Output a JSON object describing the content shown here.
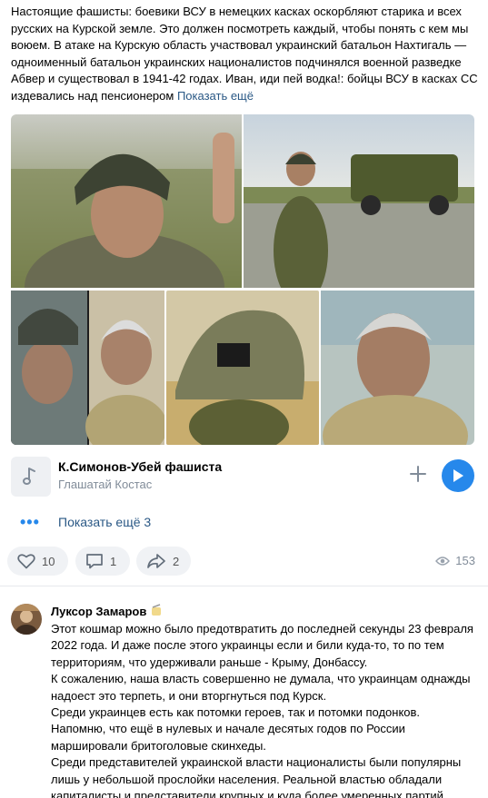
{
  "post": {
    "text": "Настоящие фашисты: боевики ВСУ в немецких касках оскорбляют старика и всех русских на Курской земле. Это должен посмотреть каждый, чтобы понять с кем мы воюем. В атаке на Курскую область участвовал украинский батальон Нахтигаль — одноименный батальон украинских националистов подчинялся военной разведке Абвер и существовал в 1941-42 годах. Иван, иди пей водка!: бойцы ВСУ в касках СС издевались над пенсионером",
    "show_more_label": "Показать ещё"
  },
  "audio": {
    "title": "К.Симонов-Убей фашиста",
    "artist": "Глашатай Костас"
  },
  "attachments": {
    "show_more_label": "Показать ещё 3"
  },
  "actions": {
    "likes": "10",
    "comments": "1",
    "shares": "2",
    "views": "153"
  },
  "comment": {
    "author": "Луксор Замаров",
    "paragraphs": [
      "Этот кошмар можно было предотвратить до последней секунды 23 февраля 2022 года. И даже после этого украинцы если и били куда-то, то по тем территориям, что удерживали раньше - Крыму, Донбассу.",
      "К сожалению, наша власть совершенно не думала, что украинцам однажды надоест это терпеть, и они вторгнуться под Курск.",
      "Среди украинцев есть как потомки героев, так и потомки подонков. Напомню, что ещё в нулевых и начале десятых годов по России маршировали бритоголовые скинхеды.",
      "Среди представителей украинской власти националисты были популярны лишь у небольшой прослойки населения. Реальной властью обладали капиталисты и представители крупных и куда более умеренных партий,"
    ]
  },
  "colors": {
    "link": "#2a5885",
    "accent": "#2688eb",
    "muted": "#818c99",
    "pill_bg": "#f0f2f5"
  }
}
